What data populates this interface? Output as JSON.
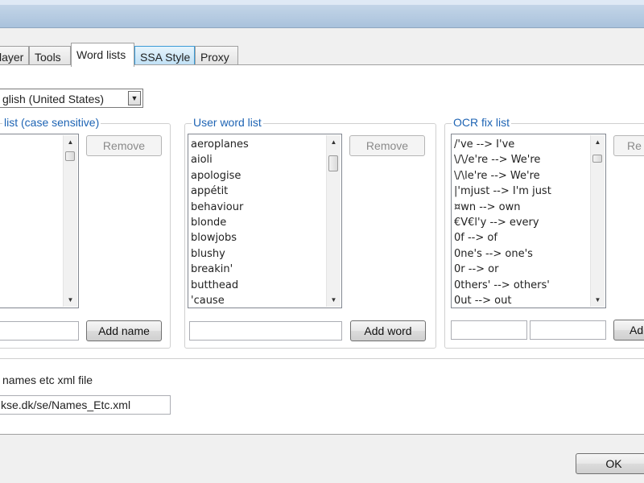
{
  "tabs": [
    {
      "label": "layer",
      "state": "normal"
    },
    {
      "label": "Tools",
      "state": "normal"
    },
    {
      "label": "Word lists",
      "state": "active"
    },
    {
      "label": "SSA Style",
      "state": "hot"
    },
    {
      "label": "Proxy",
      "state": "normal"
    }
  ],
  "language": {
    "selected": "glish (United States)"
  },
  "groups": {
    "names": {
      "title": "list (case sensitive)",
      "items": [],
      "remove_label": "Remove",
      "add_label": "Add name",
      "input_value": ""
    },
    "user": {
      "title": "User word list",
      "items": [
        "aeroplanes",
        "aioli",
        "apologise",
        "appétit",
        "behaviour",
        "blonde",
        "blowjobs",
        "blushy",
        "breakin'",
        "butthead",
        "'cause"
      ],
      "remove_label": "Remove",
      "add_label": "Add word",
      "input_value": ""
    },
    "ocr": {
      "title": "OCR fix list",
      "items": [
        "/'ve --> I've",
        "\\/\\/e're --> We're",
        "\\/\\le're --> We're",
        "|'mjust --> I'm just",
        "¤wn --> own",
        "€V€l'y --> every",
        "0f --> of",
        "0ne's --> one's",
        "0r --> or",
        "0thers' --> others'",
        "0ut --> out"
      ],
      "remove_label": "Re",
      "add_label": "Ad",
      "input1_value": "",
      "input2_value": ""
    }
  },
  "xml_section": {
    "label": "names etc xml file",
    "url": "kse.dk/se/Names_Etc.xml"
  },
  "footer": {
    "ok_label": "OK"
  },
  "colors": {
    "group_title": "#1e64b4",
    "hot_tab": "#bfe0f5"
  }
}
